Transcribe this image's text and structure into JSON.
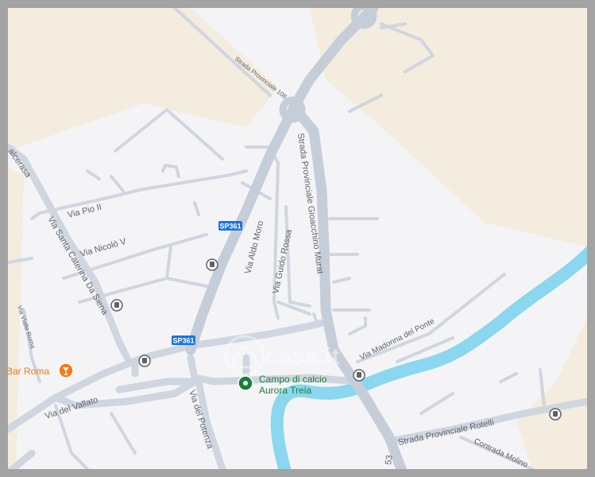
{
  "map": {
    "colors": {
      "road": "#cfd6df",
      "road_edge": "#bcc5d0",
      "land": "#f4f4f6",
      "rural": "#f3ecdf",
      "river": "#8ad7ef",
      "poi_green": "#188038",
      "poi_orange": "#f07c15",
      "label": "#5f6368",
      "shield": "#1a73e8"
    },
    "route_shields": [
      "SP361",
      "SP361"
    ],
    "street_labels": {
      "via_pio_ii": "Via Pio II",
      "via_nicolo_v": "Via Nicolò V",
      "via_santa_caterina": "Via Santa Caterina Da Siena",
      "valcerasa": "alcerasa",
      "via_aldo_moro": "Via Aldo Moro",
      "via_guido_rossa": "Via Guido Rossa",
      "strada_gioacchino_murat": "Strada Provinciale Gioacchino Murat",
      "strada_provinciale_top": "Strada Provinciale 108",
      "via_madonna_del_ponte": "Via Madonna del Ponte",
      "via_del_vallato": "Via del Vallato",
      "via_del_potenza": "Via del Potenza",
      "strada_provinciale_rotelli": "Strada Provinciale Rotelli",
      "contrada_molino": "Contrada Molino",
      "via_vialle_roma": "Via Vialle Roma",
      "road_53": "53"
    },
    "pois": {
      "bar_roma": "Bar Roma",
      "campo_line1": "Campo di calcio",
      "campo_line2": "Aurora Treia"
    },
    "watermark": "casa.it",
    "icons": [
      "bus-stop-icon",
      "bar-cocktail-icon",
      "place-pin-icon",
      "casa-house-icon"
    ]
  }
}
